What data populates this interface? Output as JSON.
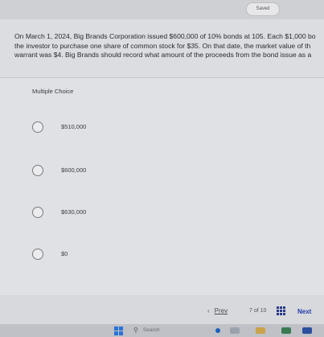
{
  "header": {
    "saved_label": "Saved"
  },
  "question": {
    "text": "On March 1, 2024, Big Brands Corporation issued $600,000 of 10% bonds at 105. Each $1,000 bo\nthe investor to purchase one share of common stock for $35. On that date, the market value of th\nwarrant was $4. Big Brands should record what amount of the proceeds from the bond issue as a"
  },
  "answers": {
    "type_label": "Multiple Choice",
    "options": [
      "$510,000",
      "$600,000",
      "$630,000",
      "$0"
    ]
  },
  "navigation": {
    "prev_label": "Prev",
    "current_page": "7",
    "of_label": "of",
    "total_pages": "10",
    "next_label": "Next"
  },
  "taskbar": {
    "search_label": "Search"
  },
  "colors": {
    "next_link": "#1f3aa8",
    "grid_icon": "#2a3a8a",
    "windows_icon": "#2a73d6"
  }
}
